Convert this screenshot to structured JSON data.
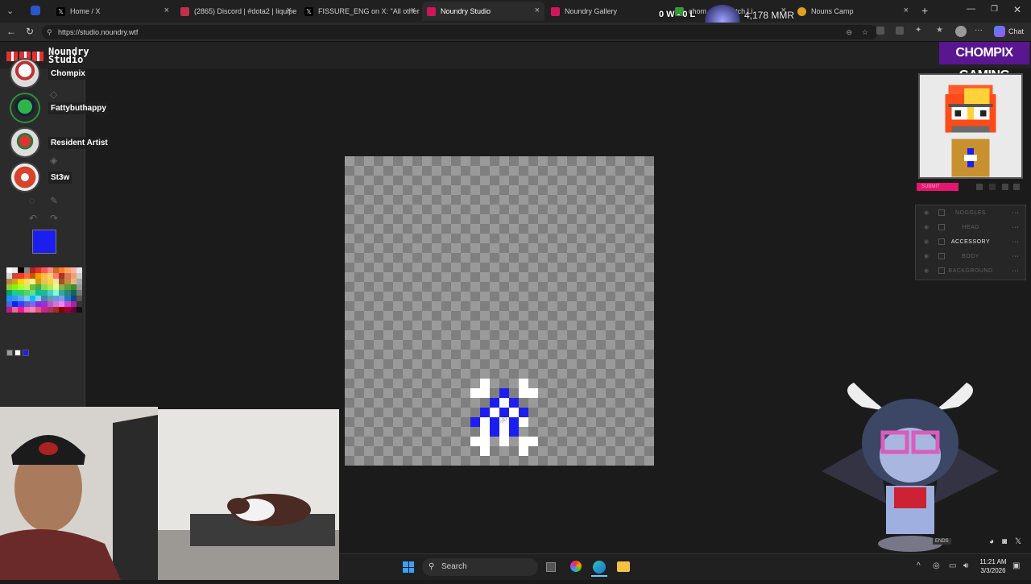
{
  "browser": {
    "tabs": [
      {
        "label": "Home / X",
        "icon": "x-logo-icon"
      },
      {
        "label": "(2865) Discord | #dota2 | liquipe",
        "icon": "discord-icon"
      },
      {
        "label": "FISSURE_ENG on X: \"All other Fi",
        "icon": "x-logo-icon"
      },
      {
        "label": "Noundry Studio",
        "icon": "noundry-icon"
      },
      {
        "label": "Noundry Gallery",
        "icon": "noundry-icon"
      },
      {
        "label": "chom   am - Watch Li",
        "icon": "twitch-icon"
      },
      {
        "label": "Nouns Camp",
        "icon": "nouns-icon"
      }
    ],
    "url": "https://studio.noundry.wtf",
    "chat_label": "Chat",
    "overlay_score": "0 W - 0 L",
    "overlay_mmr": "4,178 MMR"
  },
  "app": {
    "logo_text": "Noundry Studio",
    "current_color": "#1c1ef0",
    "palette_colors": [
      "#ffffff",
      "#eeeeee",
      "#000000",
      "#888888",
      "#b22222",
      "#e03030",
      "#ff5555",
      "#ff8a8a",
      "#d2691e",
      "#ff7a2a",
      "#ffa55a",
      "#ffb0b0",
      "#e8e8e8",
      "#d8d8d8",
      "#c44",
      "#ff3333",
      "#ff6644",
      "#cc5500",
      "#ff9900",
      "#ffbb44",
      "#ffd36b",
      "#ff7777",
      "#aa3322",
      "#dd7755",
      "#f0a070",
      "#cccccc",
      "#bb8844",
      "#d4a017",
      "#ffd700",
      "#ffe066",
      "#fff08a",
      "#c8a000",
      "#e8c060",
      "#f5d442",
      "#ffe49a",
      "#a0522d",
      "#cd853f",
      "#deb887",
      "#aaaaaa",
      "#9acd32",
      "#7cfc00",
      "#adff2f",
      "#c8f060",
      "#6bbf3a",
      "#44aa44",
      "#88dd44",
      "#b5e655",
      "#e0ff90",
      "#88b04b",
      "#5a9e3a",
      "#3c8c28",
      "#999999",
      "#00a86b",
      "#20c997",
      "#2ecc71",
      "#4cd964",
      "#66dd88",
      "#00bfa5",
      "#1abc9c",
      "#48d1cc",
      "#7fffd4",
      "#33aa99",
      "#228877",
      "#116655",
      "#777777",
      "#1e90ff",
      "#3399ff",
      "#55aaff",
      "#77ccff",
      "#00bfff",
      "#87ceeb",
      "#4682b4",
      "#5f9ea0",
      "#6495ed",
      "#7b9fe0",
      "#2277cc",
      "#114488",
      "#555555",
      "#4169e1",
      "#1c1ef0",
      "#3344ff",
      "#6a5acd",
      "#7b68ee",
      "#8a2be2",
      "#9932cc",
      "#ba55d3",
      "#da70d6",
      "#ee82ee",
      "#cc44cc",
      "#aa22aa",
      "#333333",
      "#c71585",
      "#db7093",
      "#ff1493",
      "#ff69b4",
      "#ff82ab",
      "#e75480",
      "#d02090",
      "#b03060",
      "#a52a2a",
      "#8b0000",
      "#990033",
      "#660033",
      "#111111"
    ],
    "recent_colors": [
      "#9a9a9a",
      "#ffffff",
      "#1c1ef0"
    ],
    "chatters": [
      {
        "name": "Chompix"
      },
      {
        "name": "Fattybuthappy"
      },
      {
        "name": "Resident Artist"
      },
      {
        "name": "St3w"
      }
    ],
    "submit_label": "SUBMIT",
    "layers": [
      {
        "name": "NOGGLES",
        "selected": false
      },
      {
        "name": "HEAD",
        "selected": false
      },
      {
        "name": "ACCESSORY",
        "selected": true
      },
      {
        "name": "BODY",
        "selected": false
      },
      {
        "name": "BACKGROUND",
        "selected": false
      }
    ],
    "canvas_grid": 32,
    "sprite_pixels": [
      [
        14,
        23,
        "w"
      ],
      [
        18,
        23,
        "w"
      ],
      [
        13,
        24,
        "w"
      ],
      [
        14,
        24,
        "w"
      ],
      [
        16,
        24,
        "b"
      ],
      [
        18,
        24,
        "w"
      ],
      [
        19,
        24,
        "w"
      ],
      [
        15,
        25,
        "b"
      ],
      [
        16,
        25,
        "w"
      ],
      [
        17,
        25,
        "b"
      ],
      [
        14,
        26,
        "b"
      ],
      [
        15,
        26,
        "w"
      ],
      [
        16,
        26,
        "b"
      ],
      [
        17,
        26,
        "w"
      ],
      [
        18,
        26,
        "b"
      ],
      [
        13,
        27,
        "b"
      ],
      [
        14,
        27,
        "w"
      ],
      [
        15,
        27,
        "b"
      ],
      [
        16,
        27,
        "w"
      ],
      [
        17,
        27,
        "b"
      ],
      [
        18,
        27,
        "w"
      ],
      [
        14,
        28,
        "w"
      ],
      [
        15,
        28,
        "b"
      ],
      [
        16,
        28,
        "w"
      ],
      [
        17,
        28,
        "b"
      ],
      [
        13,
        29,
        "w"
      ],
      [
        14,
        29,
        "w"
      ],
      [
        16,
        29,
        "w"
      ],
      [
        18,
        29,
        "w"
      ],
      [
        19,
        29,
        "w"
      ],
      [
        14,
        30,
        "w"
      ],
      [
        18,
        30,
        "w"
      ]
    ]
  },
  "overlay": {
    "brand_text": "CHOMPIX GAMING",
    "corner_text": "ENDS"
  },
  "taskbar": {
    "search_placeholder": "Search",
    "time": "11:21 AM",
    "date": "3/3/2026"
  }
}
